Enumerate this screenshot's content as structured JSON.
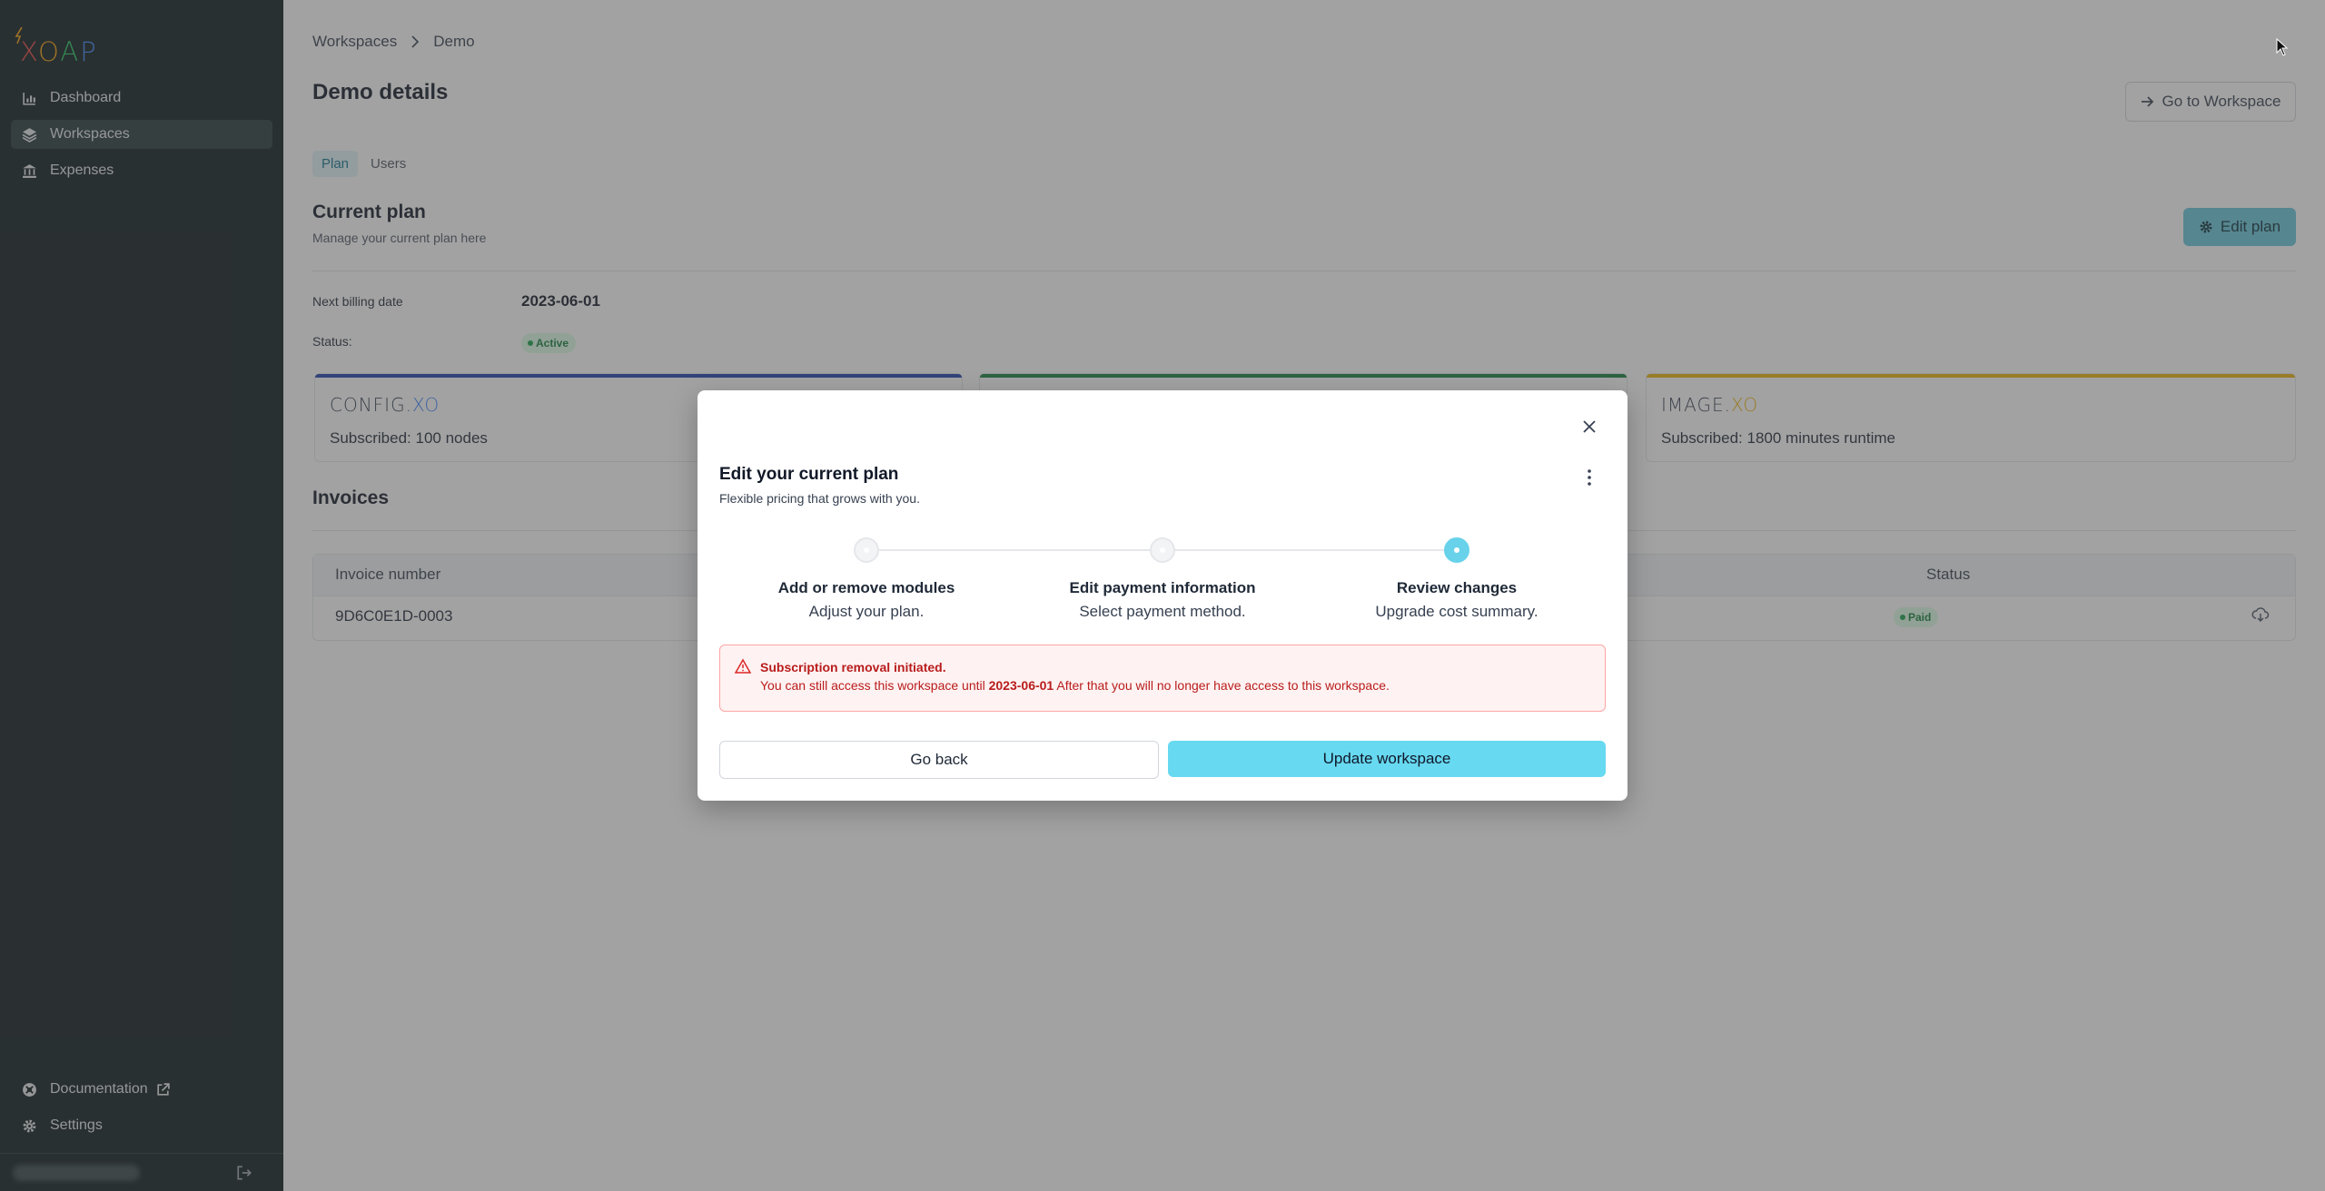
{
  "brand": {
    "logo_text": "XOAP"
  },
  "sidebar": {
    "items": [
      {
        "label": "Dashboard",
        "icon": "bar-chart-icon"
      },
      {
        "label": "Workspaces",
        "icon": "layers-icon",
        "active": true
      },
      {
        "label": "Expenses",
        "icon": "bank-icon"
      }
    ],
    "bottom": [
      {
        "label": "Documentation",
        "icon": "help-circle-icon",
        "external": true
      },
      {
        "label": "Settings",
        "icon": "gear-icon"
      }
    ]
  },
  "breadcrumb": {
    "root": "Workspaces",
    "current": "Demo"
  },
  "page": {
    "title": "Demo details",
    "goto_label": "Go to Workspace"
  },
  "tabs": [
    {
      "label": "Plan",
      "active": true
    },
    {
      "label": "Users"
    }
  ],
  "plan": {
    "title": "Current plan",
    "subtitle": "Manage your current plan here",
    "edit_label": "Edit plan",
    "next_billing_label": "Next billing date",
    "next_billing_value": "2023-06-01",
    "status_label": "Status:",
    "status_value": "Active"
  },
  "modules": [
    {
      "logo_a": "CONFIG.",
      "logo_b": "XO",
      "subscribed": "Subscribed: 100 nodes",
      "color": "#1e40af"
    },
    {
      "logo_a": "",
      "logo_b": "",
      "subscribed": "",
      "color": "#15803d"
    },
    {
      "logo_a": "IMAGE.",
      "logo_b": "XO",
      "subscribed": "Subscribed: 1800 minutes runtime",
      "color": "#eab308"
    }
  ],
  "invoices": {
    "title": "Invoices",
    "columns": {
      "number": "Invoice number",
      "status": "Status"
    },
    "rows": [
      {
        "number": "9D6C0E1D-0003",
        "status": "Paid"
      }
    ]
  },
  "modal": {
    "title": "Edit your current plan",
    "subtitle": "Flexible pricing that grows with you.",
    "steps": [
      {
        "title": "Add or remove modules",
        "desc": "Adjust your plan."
      },
      {
        "title": "Edit payment information",
        "desc": "Select payment method."
      },
      {
        "title": "Review changes",
        "desc": "Upgrade cost summary.",
        "active": true
      }
    ],
    "alert": {
      "title": "Subscription removal initiated.",
      "text_before": "You can still access this workspace until",
      "date": "2023-06-01",
      "text_after": "After that you will no longer have access to this workspace."
    },
    "back_label": "Go back",
    "update_label": "Update workspace"
  }
}
